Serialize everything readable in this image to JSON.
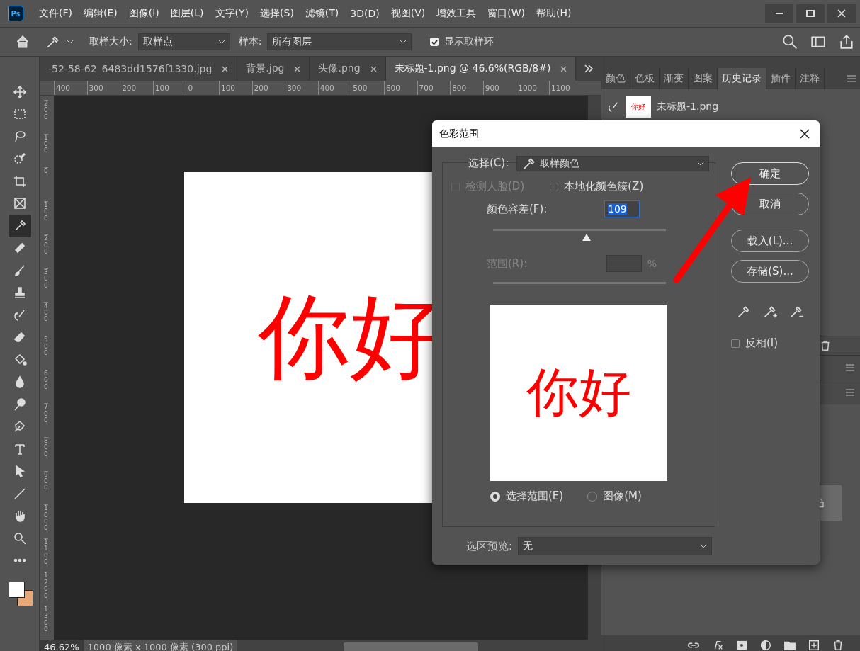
{
  "app_icon": "Ps",
  "menu": [
    "文件(F)",
    "编辑(E)",
    "图像(I)",
    "图层(L)",
    "文字(Y)",
    "选择(S)",
    "滤镜(T)",
    "3D(D)",
    "视图(V)",
    "增效工具",
    "窗口(W)",
    "帮助(H)"
  ],
  "options_bar": {
    "sample_size_label": "取样大小:",
    "sample_size": "取样点",
    "sample_label": "样本:",
    "sample": "所有图层",
    "show_ring": {
      "label": "显示取样环",
      "checked": true
    }
  },
  "doc_tabs": [
    {
      "label": "-52-58-62_6483dd1576f1330.jpg",
      "selected": false
    },
    {
      "label": "背景.jpg",
      "selected": false
    },
    {
      "label": "头像.png",
      "selected": false
    },
    {
      "label": "未标题-1.png @ 46.6%(RGB/8#)",
      "selected": true
    }
  ],
  "ruler_h": [
    "400",
    "300",
    "200",
    "100",
    "0",
    "100",
    "200",
    "300",
    "400",
    "500",
    "600",
    "700",
    "800",
    "900",
    "1000",
    "1100"
  ],
  "ruler_v": [
    "200",
    "100",
    "0",
    "100",
    "200",
    "300",
    "400",
    "500",
    "600",
    "700",
    "800",
    "900",
    "1000",
    "1100",
    "1200",
    "1300"
  ],
  "tools": [
    {
      "kind": "move",
      "selected": false
    },
    {
      "kind": "marquee",
      "selected": false
    },
    {
      "kind": "lasso",
      "selected": false
    },
    {
      "kind": "quick",
      "selected": false
    },
    {
      "kind": "crop",
      "selected": false
    },
    {
      "kind": "frame",
      "selected": false
    },
    {
      "kind": "eyedropper",
      "selected": true
    },
    {
      "kind": "bandage",
      "selected": false
    },
    {
      "kind": "brush",
      "selected": false
    },
    {
      "kind": "stamp",
      "selected": false
    },
    {
      "kind": "history",
      "selected": false
    },
    {
      "kind": "eraser",
      "selected": false
    },
    {
      "kind": "bucket",
      "selected": false
    },
    {
      "kind": "drop",
      "selected": false
    },
    {
      "kind": "dodge",
      "selected": false
    },
    {
      "kind": "pen",
      "selected": false
    },
    {
      "kind": "type",
      "selected": false
    },
    {
      "kind": "pointer",
      "selected": false
    },
    {
      "kind": "line",
      "selected": false
    },
    {
      "kind": "hand",
      "selected": false
    },
    {
      "kind": "zoom",
      "selected": false
    },
    {
      "kind": "more",
      "selected": false
    }
  ],
  "swatches": [
    {
      "kind": "background",
      "color": "#e8a878"
    },
    {
      "kind": "foreground",
      "color": "#ffffff"
    }
  ],
  "canvas": {
    "text": "你好"
  },
  "status_bar": {
    "zoom": "46.62%",
    "info": "1000 像素 x 1000 像素 (300 ppi)"
  },
  "panel_tabs": [
    {
      "label": "颜色",
      "selected": false
    },
    {
      "label": "色板",
      "selected": false
    },
    {
      "label": "渐变",
      "selected": false
    },
    {
      "label": "图案",
      "selected": false
    },
    {
      "label": "历史记录",
      "selected": true
    },
    {
      "label": "插件",
      "selected": false
    },
    {
      "label": "注释",
      "selected": false
    }
  ],
  "history": [
    {
      "thumbnail_text": "你好",
      "label": "未标题-1.png"
    }
  ],
  "dialog": {
    "title": "色彩范围",
    "select_label": "选择(C):",
    "select_value": "取样颜色",
    "detect_faces": {
      "label": "检测人脸(D)",
      "checked": false,
      "disabled": true
    },
    "localized": {
      "label": "本地化颜色簇(Z)",
      "checked": false
    },
    "fuzziness": {
      "label": "颜色容差(F):",
      "value": "109",
      "level": 0.54
    },
    "range": {
      "label": "范围(R):",
      "unit": "%",
      "disabled": true
    },
    "preview_text": "你好",
    "radios": [
      {
        "label": "选择范围(E)",
        "selected": true
      },
      {
        "label": "图像(M)",
        "selected": false
      }
    ],
    "preview_label": "选区预览:",
    "preview_value": "无",
    "buttons": [
      "确定",
      "取消",
      "载入(L)...",
      "存储(S)..."
    ],
    "invert": {
      "label": "反相(I)",
      "checked": false
    }
  }
}
